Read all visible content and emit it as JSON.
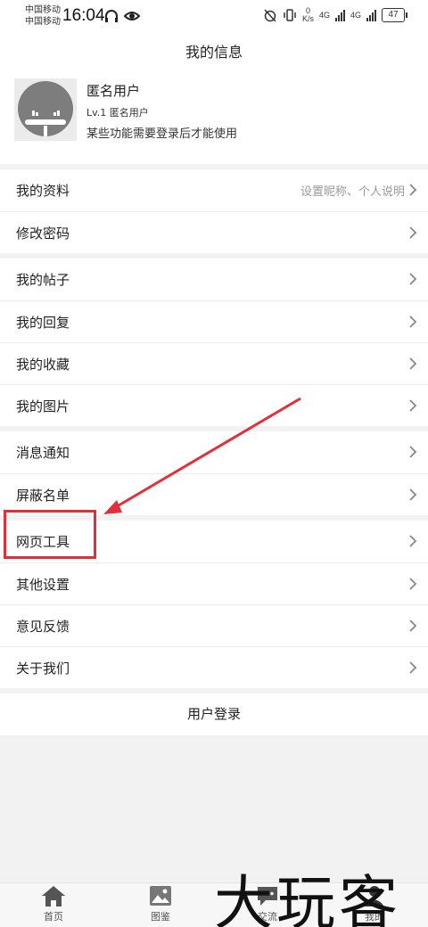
{
  "status_bar": {
    "carrier_1": "中国移动",
    "carrier_2": "中国移动",
    "time": "16:04",
    "net_speed_value": "0",
    "net_speed_unit": "K/s",
    "net_type_1": "4G",
    "net_type_2": "4G",
    "battery": "47"
  },
  "header": {
    "title": "我的信息"
  },
  "profile": {
    "name": "匿名用户",
    "level": "Lv.1 匿名用户",
    "note": "某些功能需要登录后才能使用"
  },
  "groups": [
    [
      {
        "label": "我的资料",
        "hint": "设置昵称、个人说明"
      },
      {
        "label": "修改密码"
      }
    ],
    [
      {
        "label": "我的帖子"
      },
      {
        "label": "我的回复"
      },
      {
        "label": "我的收藏"
      },
      {
        "label": "我的图片"
      }
    ],
    [
      {
        "label": "消息通知"
      },
      {
        "label": "屏蔽名单"
      }
    ],
    [
      {
        "label": "网页工具"
      },
      {
        "label": "其他设置"
      },
      {
        "label": "意见反馈"
      },
      {
        "label": "关于我们"
      }
    ]
  ],
  "login_label": "用户登录",
  "tabbar": [
    {
      "label": "首页",
      "icon": "home-icon"
    },
    {
      "label": "图鉴",
      "icon": "image-icon"
    },
    {
      "label": "交流",
      "icon": "chat-icon"
    },
    {
      "label": "我的",
      "icon": "user-icon"
    }
  ],
  "watermark": "大玩客",
  "colors": {
    "highlight": "#e0303a",
    "background": "#f2f2f2"
  }
}
